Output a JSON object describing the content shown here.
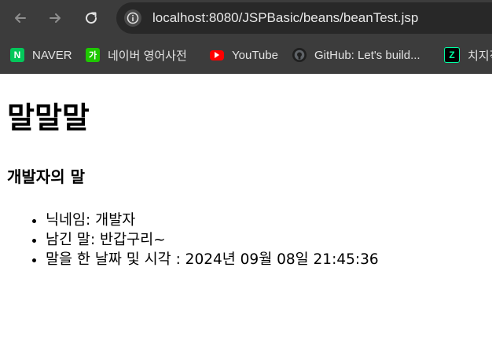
{
  "browser": {
    "url": "localhost:8080/JSPBasic/beans/beanTest.jsp",
    "bookmarks": [
      {
        "label": "NAVER",
        "icon": "naver-icon",
        "color": "#03c75a"
      },
      {
        "label": "네이버 영어사전",
        "icon": "naver-dictionary-icon",
        "color": "#1ec800"
      },
      {
        "label": "YouTube",
        "icon": "youtube-icon",
        "color": "#ff0000"
      },
      {
        "label": "GitHub: Let's build...",
        "icon": "github-icon",
        "color": "#e3e3e3"
      },
      {
        "label": "치지직",
        "icon": "chzzk-icon",
        "color": "#00ffa3"
      }
    ]
  },
  "page": {
    "heading": "말말말",
    "subheading": "개발자의 말",
    "items": [
      "닉네임: 개발자",
      "남긴 말: 반갑구리~",
      "말을 한 날짜 및 시각 : 2024년 09월 08일 21:45:36"
    ]
  }
}
